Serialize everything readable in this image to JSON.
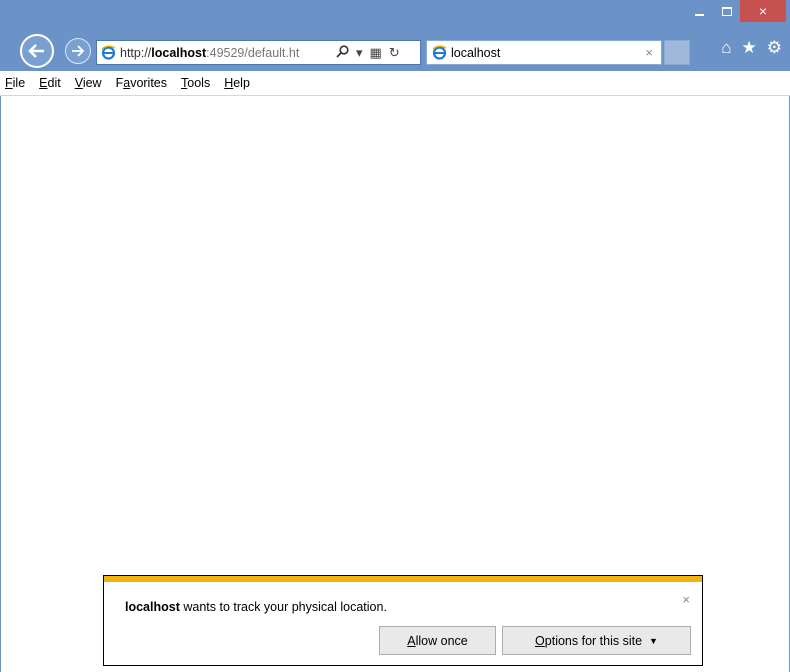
{
  "window": {
    "controls": {
      "minimize": "minimize",
      "maximize": "maximize",
      "close": "×"
    }
  },
  "nav": {
    "back_icon": "back-arrow-icon",
    "forward_icon": "forward-arrow-icon",
    "address": {
      "prefix": "http://",
      "host": "localhost",
      "rest": ":49529/default.ht"
    },
    "tab": {
      "title": "localhost",
      "close": "×"
    },
    "tools": {
      "search": "⚲",
      "dropdown": "▾",
      "compat": "▦",
      "refresh": "↻"
    },
    "right_tools": {
      "home": "⌂",
      "favorites": "★",
      "settings": "⚙"
    }
  },
  "menu": {
    "items": [
      {
        "accel": "F",
        "rest": "ile"
      },
      {
        "accel": "E",
        "rest": "dit"
      },
      {
        "accel": "V",
        "rest": "iew"
      },
      {
        "pre": "F",
        "accel": "a",
        "rest": "vorites"
      },
      {
        "accel": "T",
        "rest": "ools"
      },
      {
        "accel": "H",
        "rest": "elp"
      }
    ]
  },
  "notification": {
    "host": "localhost",
    "message": " wants to track your physical location.",
    "close": "×",
    "allow_accel": "A",
    "allow_rest": "llow once",
    "options_accel": "O",
    "options_rest": "ptions for this site",
    "options_caret": "▼",
    "stripe_color": "#f1b30d"
  }
}
